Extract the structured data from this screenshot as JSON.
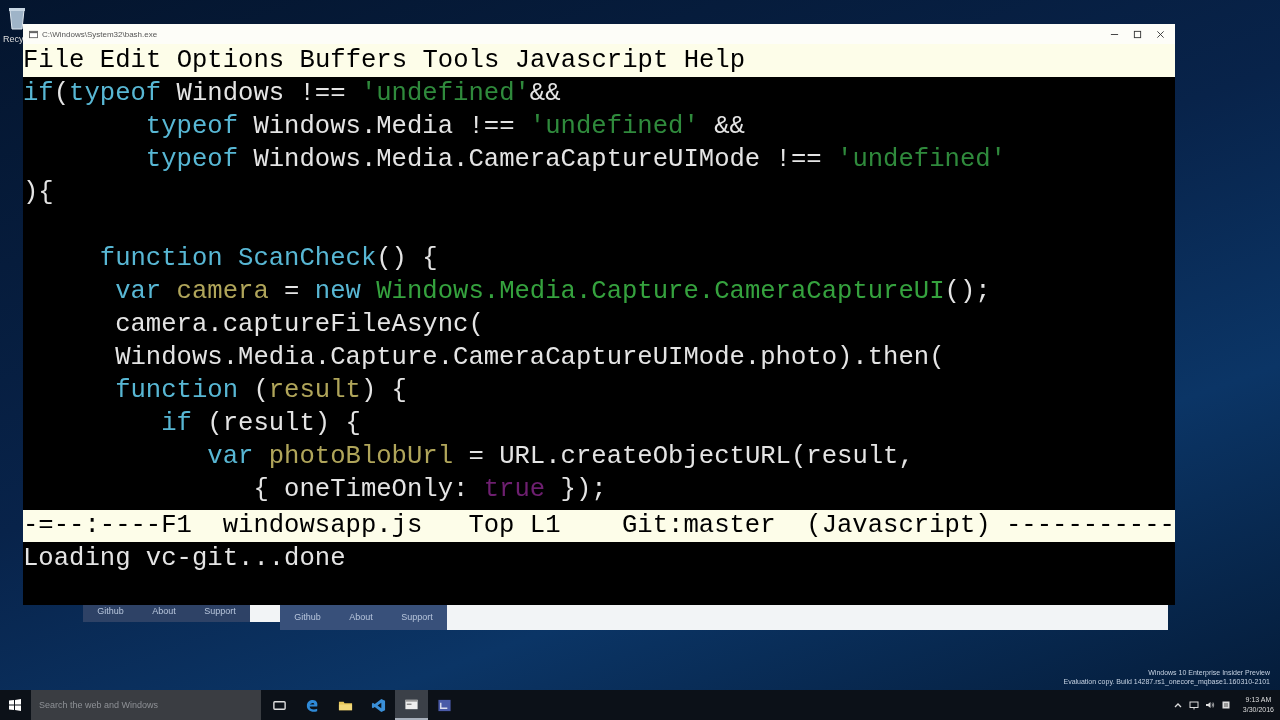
{
  "desktop": {
    "recycle_bin_label": "Recy"
  },
  "background_pages": [
    {
      "links": [
        "Github",
        "About",
        "Support"
      ]
    },
    {
      "links": [
        "Github",
        "About",
        "Support"
      ]
    }
  ],
  "window": {
    "title": "C:\\Windows\\System32\\bash.exe",
    "menu": [
      "File",
      "Edit",
      "Options",
      "Buffers",
      "Tools",
      "Javascript",
      "Help"
    ],
    "code_blocks": [
      {
        "lines": [
          {
            "segments": [
              {
                "text": "if",
                "kind": "keyword"
              },
              {
                "text": "(",
                "kind": "plain"
              },
              {
                "text": "typeof",
                "kind": "keyword"
              },
              {
                "text": " Windows !== ",
                "kind": "plain"
              },
              {
                "text": "'undefined'",
                "kind": "string"
              },
              {
                "text": "&&",
                "kind": "plain"
              }
            ]
          },
          {
            "segments": [
              {
                "text": "        typeof",
                "kind": "keyword"
              },
              {
                "text": " Windows.Media !== ",
                "kind": "plain"
              },
              {
                "text": "'undefined'",
                "kind": "string"
              },
              {
                "text": " &&",
                "kind": "plain"
              }
            ]
          },
          {
            "segments": [
              {
                "text": "        typeof",
                "kind": "keyword"
              },
              {
                "text": " Windows.Media.CameraCaptureUIMode !== ",
                "kind": "plain"
              },
              {
                "text": "'undefined'",
                "kind": "string"
              }
            ]
          },
          {
            "segments": [
              {
                "text": "){",
                "kind": "plain"
              }
            ]
          }
        ]
      },
      {
        "lines": [
          {
            "segments": [
              {
                "text": "     function ScanCheck",
                "kind": "keyword"
              },
              {
                "text": "() {",
                "kind": "plain"
              }
            ]
          },
          {
            "segments": [
              {
                "text": "      var ",
                "kind": "keyword"
              },
              {
                "text": "camera",
                "kind": "variable"
              },
              {
                "text": " = ",
                "kind": "plain"
              },
              {
                "text": "new ",
                "kind": "keyword"
              },
              {
                "text": "Windows.Media.Capture.CameraCaptureUI",
                "kind": "type"
              },
              {
                "text": "();",
                "kind": "plain"
              }
            ]
          },
          {
            "segments": [
              {
                "text": "      camera.captureFileAsync(",
                "kind": "plain"
              }
            ]
          },
          {
            "segments": [
              {
                "text": "      Windows.Media.Capture.CameraCaptureUIMode.photo).then(",
                "kind": "plain"
              }
            ]
          },
          {
            "segments": [
              {
                "text": "      function",
                "kind": "keyword"
              },
              {
                "text": " (",
                "kind": "plain"
              },
              {
                "text": "result",
                "kind": "variable"
              },
              {
                "text": ") {",
                "kind": "plain"
              }
            ]
          },
          {
            "segments": [
              {
                "text": "         if",
                "kind": "keyword"
              },
              {
                "text": " (result) {",
                "kind": "plain"
              }
            ]
          },
          {
            "segments": [
              {
                "text": "            var ",
                "kind": "keyword"
              },
              {
                "text": "photoBlobUrl",
                "kind": "variable"
              },
              {
                "text": " = URL.createObjectURL(result,",
                "kind": "plain"
              }
            ]
          },
          {
            "segments": [
              {
                "text": "               { oneTimeOnly: ",
                "kind": "plain"
              },
              {
                "text": "true",
                "kind": "constant"
              },
              {
                "text": " });",
                "kind": "plain"
              }
            ]
          }
        ]
      }
    ],
    "mode_line": "-=--:----F1  windowsapp.js   Top L1    Git:master  (Javascript) -----------",
    "echo_area": "Loading vc-git...done"
  },
  "watermark_lines": [
    "Windows 10 Enterprise Insider Preview",
    "Evaluation copy. Build 14287.rs1_onecore_mqbase1.160310-2101"
  ],
  "taskbar": {
    "search": {
      "placeholder": "Search the web and Windows"
    },
    "apps": [
      {
        "selected": false
      },
      {
        "selected": false
      },
      {
        "selected": false
      },
      {
        "selected": false
      },
      {
        "selected": true
      },
      {
        "selected": false
      }
    ],
    "time": "9:13 AM",
    "date": "3/30/2016"
  }
}
